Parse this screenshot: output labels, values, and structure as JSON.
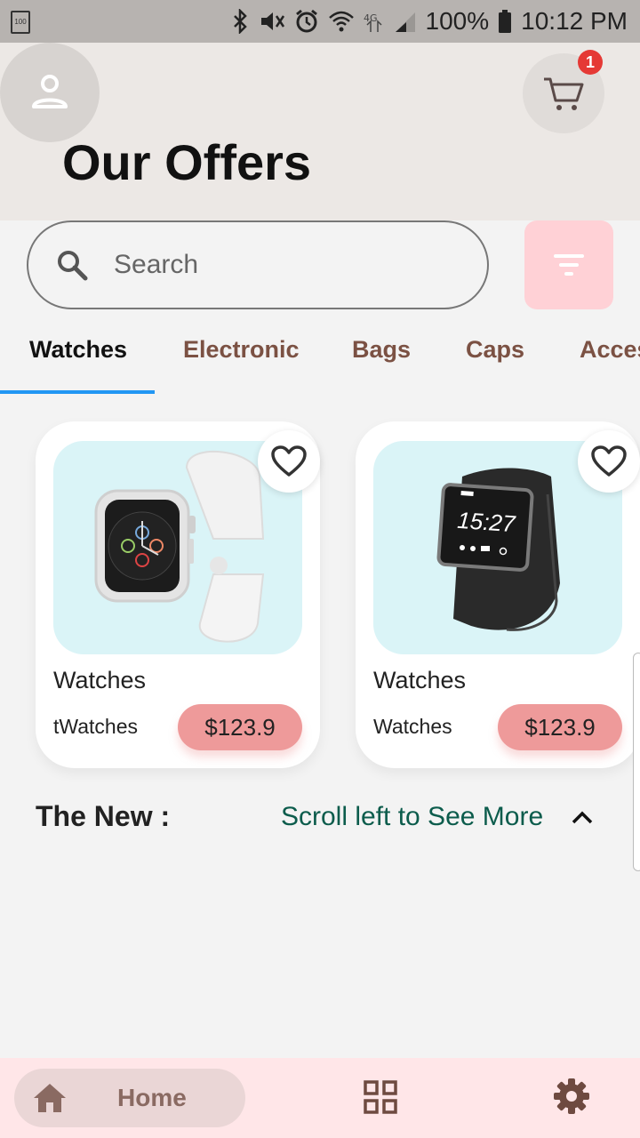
{
  "status_bar": {
    "battery_small": "100",
    "battery_pct": "100%",
    "time": "10:12 PM",
    "icons": [
      "bluetooth-icon",
      "mute-icon",
      "alarm-icon",
      "wifi-icon",
      "lte-icon",
      "signal-icon",
      "battery-icon"
    ]
  },
  "header": {
    "title": "Our Offers",
    "cart_badge": "1"
  },
  "search": {
    "placeholder": "Search"
  },
  "tabs": [
    {
      "label": "Watches",
      "active": true
    },
    {
      "label": "Electronic"
    },
    {
      "label": "Bags"
    },
    {
      "label": "Caps"
    },
    {
      "label": "Acces"
    }
  ],
  "products": [
    {
      "name": "Watches",
      "subtitle": "tWatches",
      "price": "$123.9",
      "image": "white-smartwatch"
    },
    {
      "name": "Watches",
      "subtitle": "Watches",
      "price": "$123.9",
      "image": "black-smartwatch",
      "screen_time": "15:27"
    }
  ],
  "section": {
    "title": "The New :",
    "scroll_hint": "Scroll left to See More"
  },
  "bottom_nav": {
    "home_label": "Home"
  },
  "colors": {
    "accent_blue": "#2196f3",
    "price_pink": "#ee9a9a",
    "filter_pink": "#ffd1d6",
    "tab_brown": "#7b5143",
    "link_green": "#0c5c4c"
  }
}
